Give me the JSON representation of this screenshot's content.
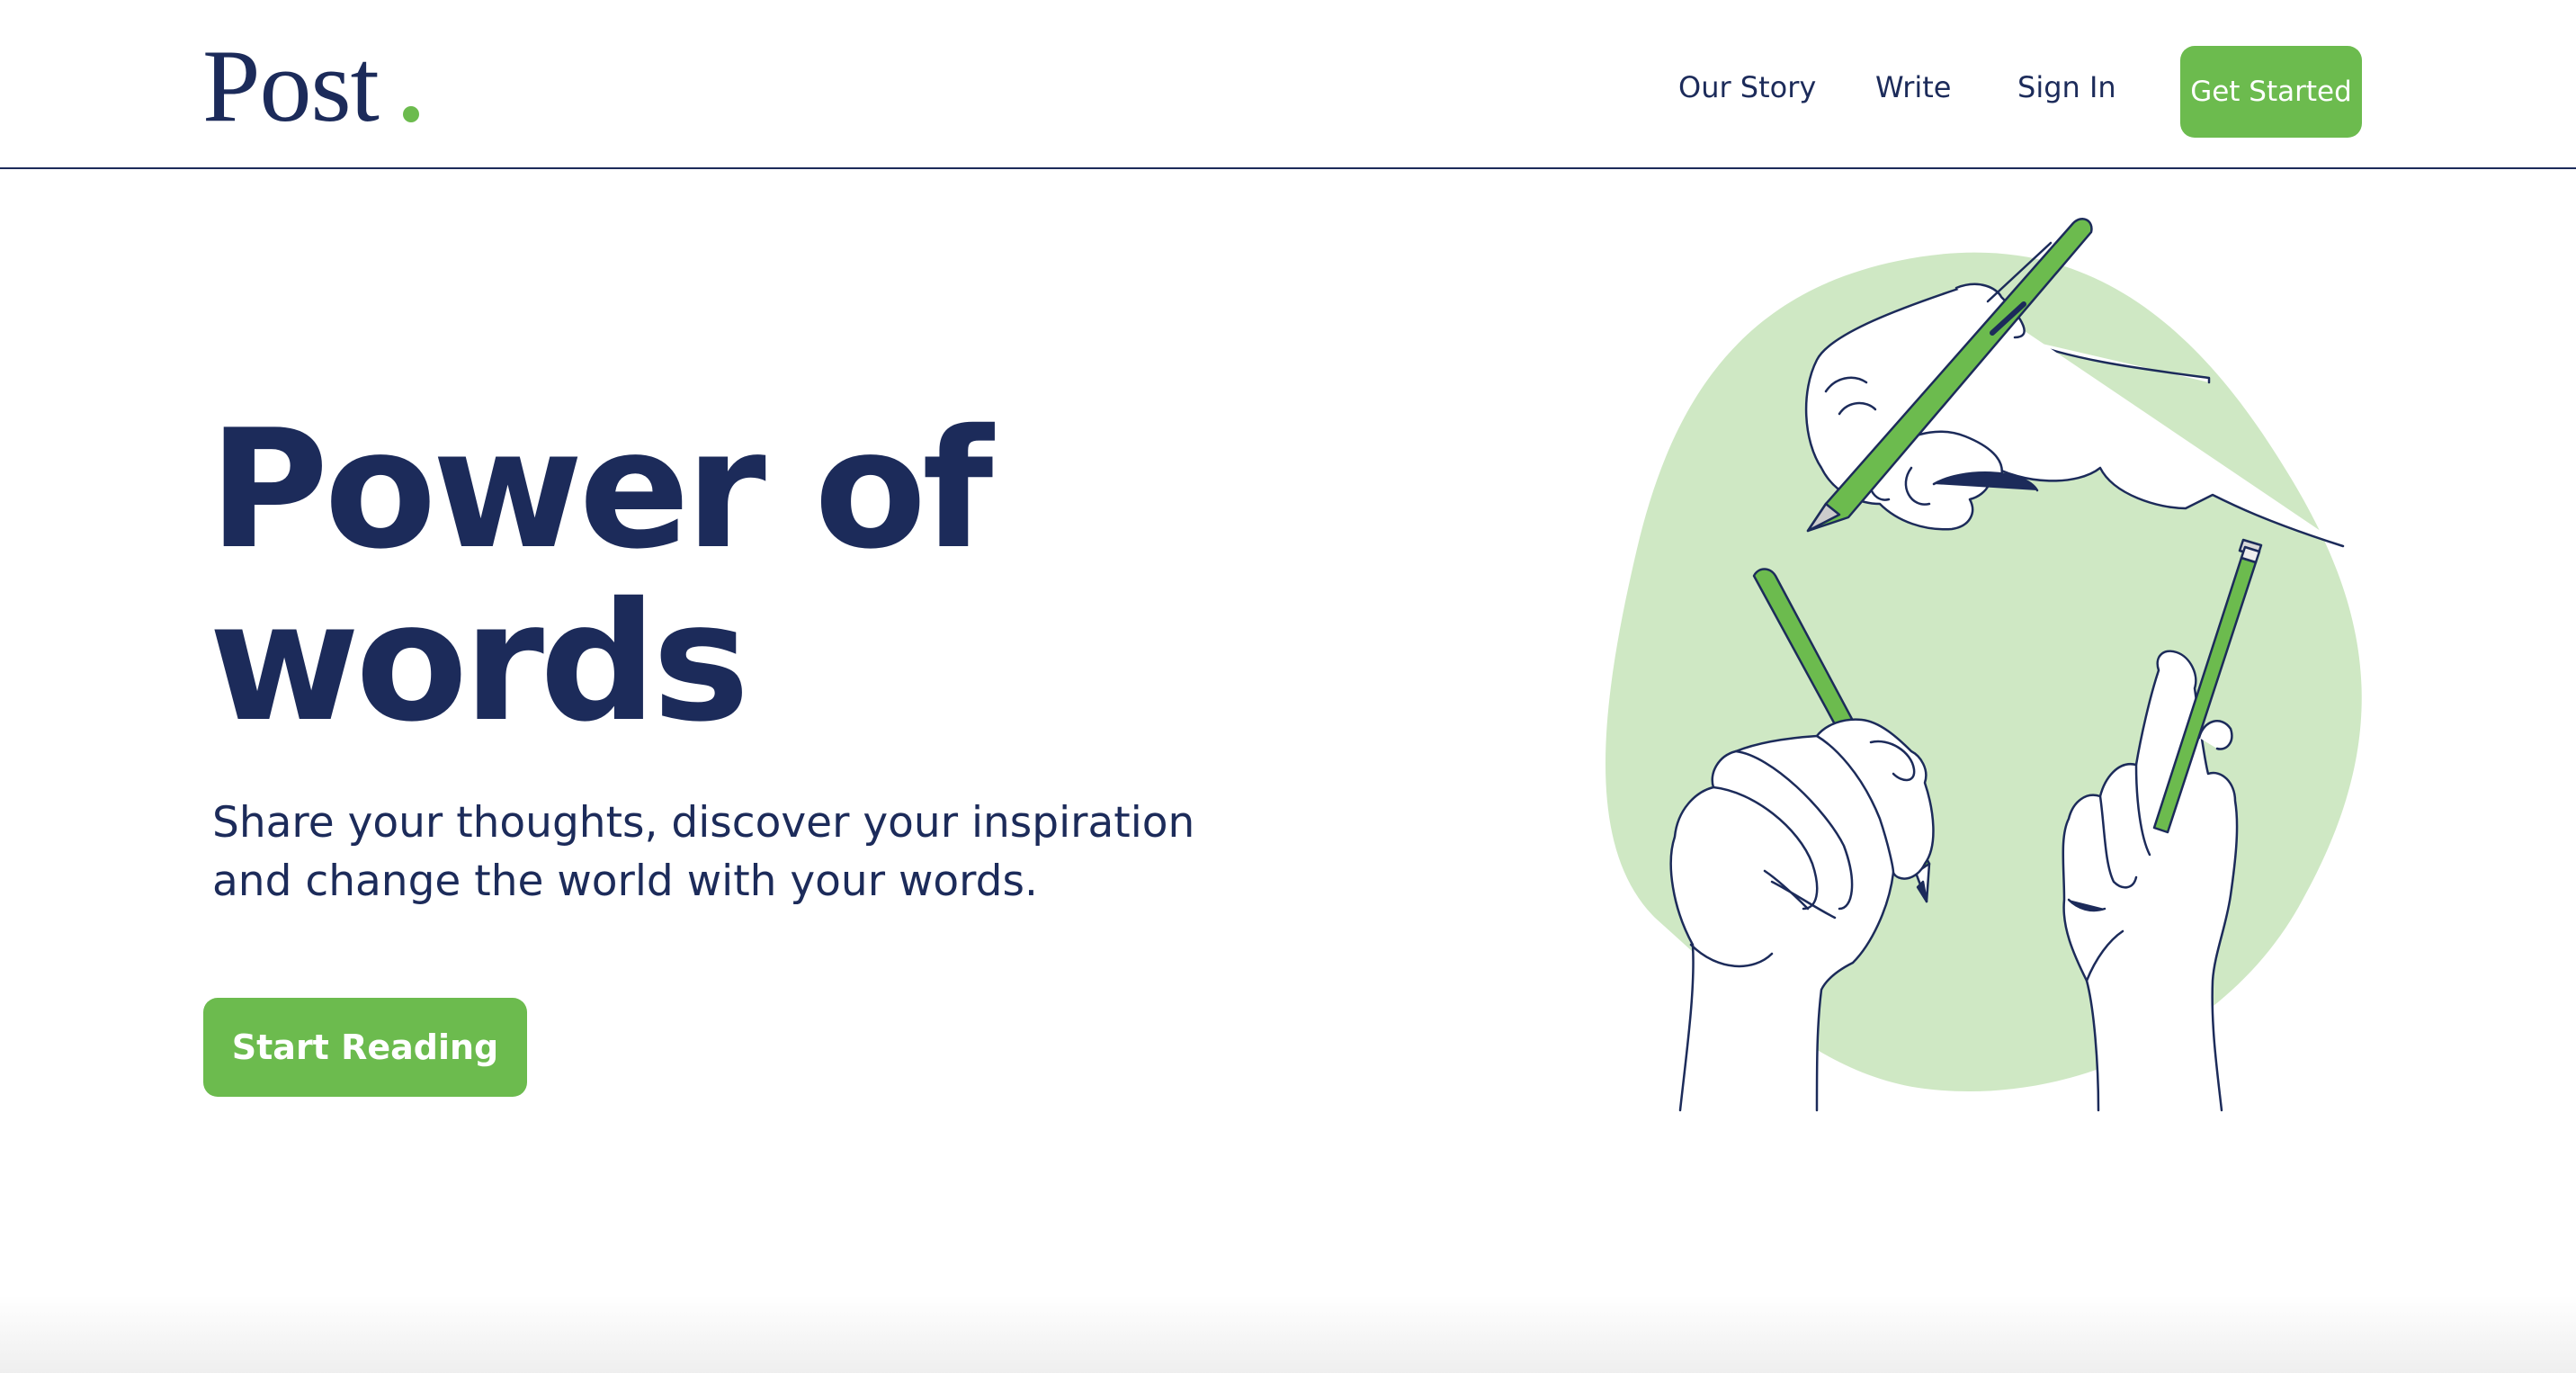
{
  "header": {
    "logo": "Post",
    "nav": {
      "our_story": "Our Story",
      "write": "Write",
      "sign_in": "Sign In",
      "get_started": "Get Started"
    }
  },
  "hero": {
    "title_line1": "Power of",
    "title_line2": "words",
    "subtitle": "Share your thoughts, discover your inspiration and change the world with your words.",
    "cta": "Start Reading"
  },
  "colors": {
    "brand_navy": "#1c2b5a",
    "accent_green": "#6cbb4e",
    "blob_green": "#cfe8c4"
  },
  "illustration": {
    "name": "hands-writing-illustration"
  }
}
